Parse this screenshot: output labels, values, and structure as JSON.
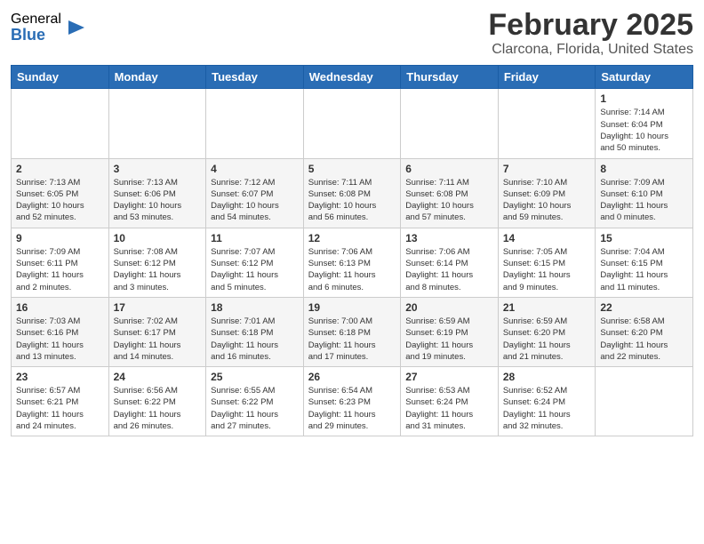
{
  "header": {
    "logo_general": "General",
    "logo_blue": "Blue",
    "month_title": "February 2025",
    "location": "Clarcona, Florida, United States"
  },
  "days_of_week": [
    "Sunday",
    "Monday",
    "Tuesday",
    "Wednesday",
    "Thursday",
    "Friday",
    "Saturday"
  ],
  "weeks": [
    [
      {
        "day": "",
        "info": ""
      },
      {
        "day": "",
        "info": ""
      },
      {
        "day": "",
        "info": ""
      },
      {
        "day": "",
        "info": ""
      },
      {
        "day": "",
        "info": ""
      },
      {
        "day": "",
        "info": ""
      },
      {
        "day": "1",
        "info": "Sunrise: 7:14 AM\nSunset: 6:04 PM\nDaylight: 10 hours\nand 50 minutes."
      }
    ],
    [
      {
        "day": "2",
        "info": "Sunrise: 7:13 AM\nSunset: 6:05 PM\nDaylight: 10 hours\nand 52 minutes."
      },
      {
        "day": "3",
        "info": "Sunrise: 7:13 AM\nSunset: 6:06 PM\nDaylight: 10 hours\nand 53 minutes."
      },
      {
        "day": "4",
        "info": "Sunrise: 7:12 AM\nSunset: 6:07 PM\nDaylight: 10 hours\nand 54 minutes."
      },
      {
        "day": "5",
        "info": "Sunrise: 7:11 AM\nSunset: 6:08 PM\nDaylight: 10 hours\nand 56 minutes."
      },
      {
        "day": "6",
        "info": "Sunrise: 7:11 AM\nSunset: 6:08 PM\nDaylight: 10 hours\nand 57 minutes."
      },
      {
        "day": "7",
        "info": "Sunrise: 7:10 AM\nSunset: 6:09 PM\nDaylight: 10 hours\nand 59 minutes."
      },
      {
        "day": "8",
        "info": "Sunrise: 7:09 AM\nSunset: 6:10 PM\nDaylight: 11 hours\nand 0 minutes."
      }
    ],
    [
      {
        "day": "9",
        "info": "Sunrise: 7:09 AM\nSunset: 6:11 PM\nDaylight: 11 hours\nand 2 minutes."
      },
      {
        "day": "10",
        "info": "Sunrise: 7:08 AM\nSunset: 6:12 PM\nDaylight: 11 hours\nand 3 minutes."
      },
      {
        "day": "11",
        "info": "Sunrise: 7:07 AM\nSunset: 6:12 PM\nDaylight: 11 hours\nand 5 minutes."
      },
      {
        "day": "12",
        "info": "Sunrise: 7:06 AM\nSunset: 6:13 PM\nDaylight: 11 hours\nand 6 minutes."
      },
      {
        "day": "13",
        "info": "Sunrise: 7:06 AM\nSunset: 6:14 PM\nDaylight: 11 hours\nand 8 minutes."
      },
      {
        "day": "14",
        "info": "Sunrise: 7:05 AM\nSunset: 6:15 PM\nDaylight: 11 hours\nand 9 minutes."
      },
      {
        "day": "15",
        "info": "Sunrise: 7:04 AM\nSunset: 6:15 PM\nDaylight: 11 hours\nand 11 minutes."
      }
    ],
    [
      {
        "day": "16",
        "info": "Sunrise: 7:03 AM\nSunset: 6:16 PM\nDaylight: 11 hours\nand 13 minutes."
      },
      {
        "day": "17",
        "info": "Sunrise: 7:02 AM\nSunset: 6:17 PM\nDaylight: 11 hours\nand 14 minutes."
      },
      {
        "day": "18",
        "info": "Sunrise: 7:01 AM\nSunset: 6:18 PM\nDaylight: 11 hours\nand 16 minutes."
      },
      {
        "day": "19",
        "info": "Sunrise: 7:00 AM\nSunset: 6:18 PM\nDaylight: 11 hours\nand 17 minutes."
      },
      {
        "day": "20",
        "info": "Sunrise: 6:59 AM\nSunset: 6:19 PM\nDaylight: 11 hours\nand 19 minutes."
      },
      {
        "day": "21",
        "info": "Sunrise: 6:59 AM\nSunset: 6:20 PM\nDaylight: 11 hours\nand 21 minutes."
      },
      {
        "day": "22",
        "info": "Sunrise: 6:58 AM\nSunset: 6:20 PM\nDaylight: 11 hours\nand 22 minutes."
      }
    ],
    [
      {
        "day": "23",
        "info": "Sunrise: 6:57 AM\nSunset: 6:21 PM\nDaylight: 11 hours\nand 24 minutes."
      },
      {
        "day": "24",
        "info": "Sunrise: 6:56 AM\nSunset: 6:22 PM\nDaylight: 11 hours\nand 26 minutes."
      },
      {
        "day": "25",
        "info": "Sunrise: 6:55 AM\nSunset: 6:22 PM\nDaylight: 11 hours\nand 27 minutes."
      },
      {
        "day": "26",
        "info": "Sunrise: 6:54 AM\nSunset: 6:23 PM\nDaylight: 11 hours\nand 29 minutes."
      },
      {
        "day": "27",
        "info": "Sunrise: 6:53 AM\nSunset: 6:24 PM\nDaylight: 11 hours\nand 31 minutes."
      },
      {
        "day": "28",
        "info": "Sunrise: 6:52 AM\nSunset: 6:24 PM\nDaylight: 11 hours\nand 32 minutes."
      },
      {
        "day": "",
        "info": ""
      }
    ]
  ]
}
